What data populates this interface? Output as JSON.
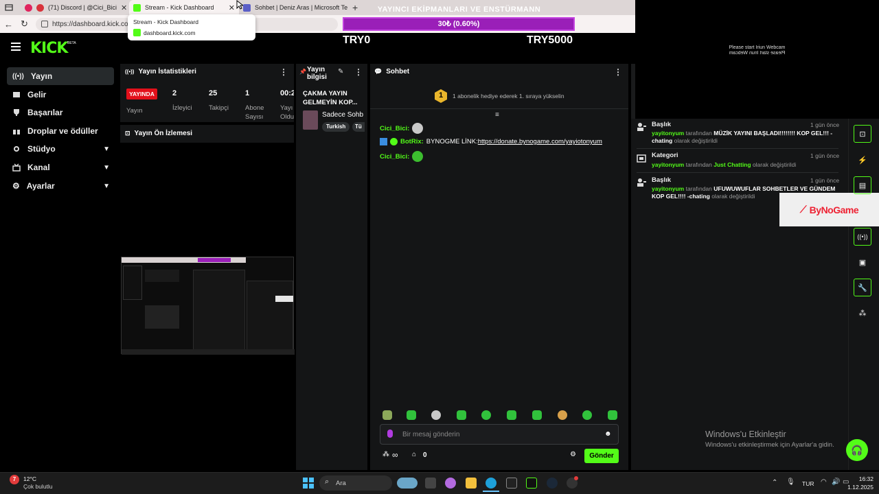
{
  "browser": {
    "tabs": [
      {
        "label": "(71) Discord | @Cici_Bici",
        "active": false
      },
      {
        "label": "Stream - Kick Dashboard",
        "active": true
      },
      {
        "label": "Sohbet | Deniz Aras | Microsoft Te",
        "active": false
      }
    ],
    "url": "https://dashboard.kick.com",
    "tooltip": {
      "title": "Stream - Kick Dashboard",
      "host": "dashboard.kick.com"
    }
  },
  "overlay": {
    "title": "YAYINCI EKİPMANLARI VE ENSTÜRMANN",
    "progress_text": "30₺ (0.60%)",
    "progress_fraction": 0.006,
    "start_label": "TRY0",
    "goal_label": "TRY5000"
  },
  "logo": {
    "text": "KICK",
    "badge": "BETA"
  },
  "sidebar": {
    "items": [
      {
        "label": "Yayın",
        "icon": "broadcast-icon",
        "active": true,
        "expandable": false
      },
      {
        "label": "Gelir",
        "icon": "revenue-icon",
        "active": false,
        "expandable": false
      },
      {
        "label": "Başarılar",
        "icon": "trophy-icon",
        "active": false,
        "expandable": false
      },
      {
        "label": "Droplar ve ödüller",
        "icon": "gift-icon",
        "active": false,
        "expandable": false
      },
      {
        "label": "Stüdyo",
        "icon": "studio-icon",
        "active": false,
        "expandable": true
      },
      {
        "label": "Kanal",
        "icon": "channel-icon",
        "active": false,
        "expandable": true
      },
      {
        "label": "Ayarlar",
        "icon": "settings-icon",
        "active": false,
        "expandable": true
      }
    ]
  },
  "stats": {
    "title": "Yayın İstatistikleri",
    "live_badge": "YAYINDA",
    "live_label": "Yayın",
    "viewers": {
      "value": "2",
      "label": "İzleyici"
    },
    "followers": {
      "value": "25",
      "label": "Takipçi"
    },
    "subs": {
      "value": "1",
      "label1": "Abone",
      "label2": "Sayısı"
    },
    "duration": {
      "value": "00:2",
      "label1": "Yayı",
      "label2": "Oldu"
    }
  },
  "preview": {
    "title": "Yayın Ön İzlemesi"
  },
  "stream_info": {
    "title1": "Yayın",
    "title2": "bilgisi",
    "stream_title1": "ÇAKMA YAYIN",
    "stream_title2": "GELMEYİN KOP...",
    "category": "Sadece Sohb",
    "tag1": "Turkish",
    "tag2": "Tü"
  },
  "chat": {
    "title": "Sohbet",
    "sub_goal_rank": "1",
    "sub_goal_text": "1 abonelik hediye ederek 1. sıraya yükselin",
    "messages": [
      {
        "user": "Cici_Bici:",
        "text": ""
      },
      {
        "user": "BotRix:",
        "text": "BYNOGME LİNK:",
        "link": "https://donate.bynogame.com/yayiotonyum"
      },
      {
        "user": "Cici_Bici:",
        "text": ""
      }
    ],
    "input_placeholder": "Bir mesaj gönderin",
    "points_value": "∞",
    "drops_value": "0",
    "send_label": "Gönder"
  },
  "webcam": {
    "line1": "Please start Iriun Webcam",
    "line2": "Please start Iriun Webcam"
  },
  "activity": [
    {
      "title": "Başlık",
      "time": "1 gün önce",
      "user": "yayitonyum",
      "pre": " tarafından ",
      "value": "MÜZİK YAYINI BAŞLADI!!!!!!!! KOP GEL!!! - chating",
      "post": " olarak değiştirildi"
    },
    {
      "title": "Kategori",
      "time": "1 gün önce",
      "user": "yayitonyum",
      "pre": " tarafından ",
      "value": "Just Chatting",
      "post": " olarak değiştirildi"
    },
    {
      "title": "Başlık",
      "time": "1 gün önce",
      "user": "yayitonyum",
      "pre": " tarafından ",
      "value": "UFUWUWUFLAR SOHBETLER VE GÜNDEM KOP GEL!!!! -chating",
      "post": " olarak değiştirildi"
    }
  ],
  "bynogame_label": "ByNoGame",
  "windows_activate": {
    "title": "Windows'u Etkinleştir",
    "subtitle": "Windows'u etkinleştirmek için Ayarlar'a gidin."
  },
  "taskbar": {
    "weather_temp": "12°C",
    "weather_desc": "Çok bulutlu",
    "weather_badge": "7",
    "search_label": "Ara",
    "lang": "TUR",
    "time": "16:32",
    "date": "1.12.2025"
  },
  "colors": {
    "kick_green": "#53fc18",
    "live_red": "#e3101b",
    "overlay_purple": "#9a1fb8"
  }
}
